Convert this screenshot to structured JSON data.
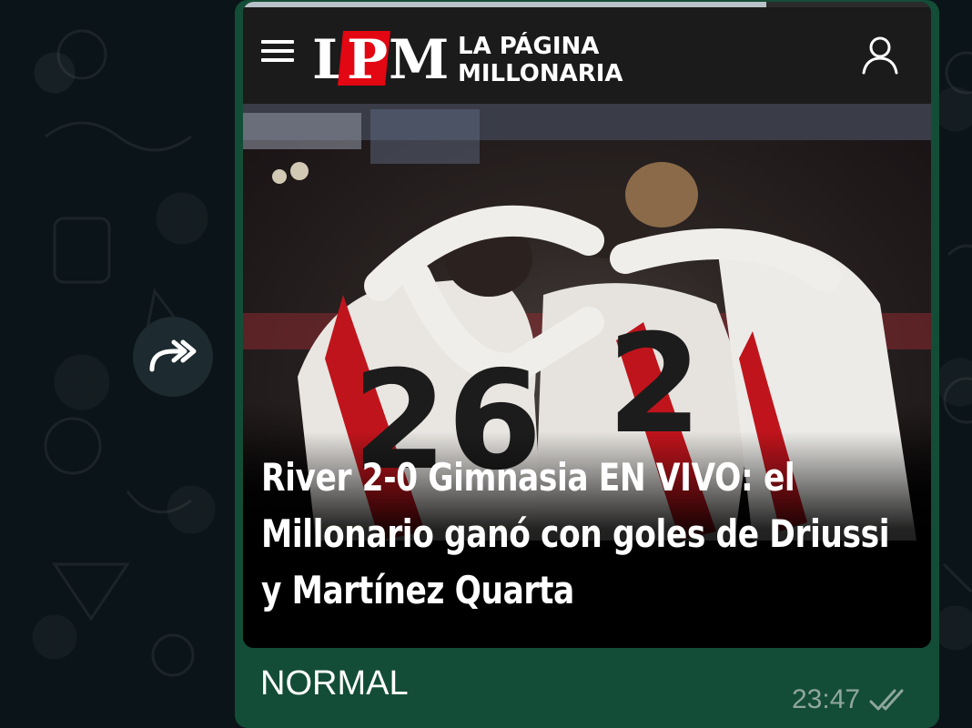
{
  "chat": {
    "forward_icon": "forward-icon",
    "message": {
      "caption": "NORMAL",
      "time": "23:47",
      "status_icon": "double-check-icon"
    }
  },
  "link_preview": {
    "site": {
      "logo_letters": "LPM",
      "name_line1": "LA PÁGINA",
      "name_line2": "MILLONARIA",
      "menu_icon": "hamburger-menu-icon",
      "account_icon": "user-icon"
    },
    "page_load_progress": 0.76,
    "headline": "River 2-0 Gimnasia EN VIVO: el Millonario ganó con goles de Driussi y Martínez Quarta",
    "hero_jersey_numbers": [
      "26",
      "2"
    ],
    "colors": {
      "brand_red": "#e30613",
      "bubble_green": "#144d37",
      "header_dark": "#1b1b1b"
    }
  }
}
